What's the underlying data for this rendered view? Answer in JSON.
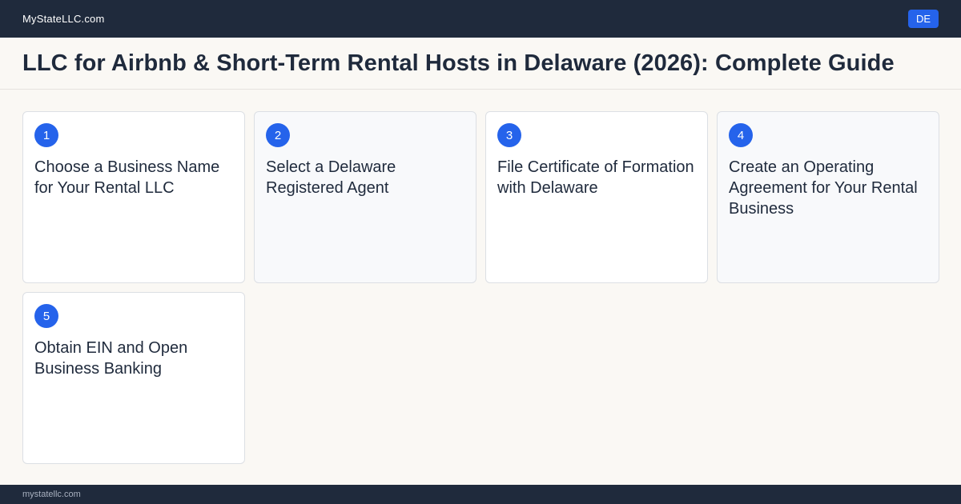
{
  "header": {
    "brand": "MyStateLLC.com",
    "state_badge": "DE"
  },
  "page": {
    "title": "LLC for Airbnb & Short-Term Rental Hosts in Delaware (2026): Complete Guide"
  },
  "steps": [
    {
      "number": "1",
      "title": "Choose a Business Name for Your Rental LLC"
    },
    {
      "number": "2",
      "title": "Select a Delaware Registered Agent"
    },
    {
      "number": "3",
      "title": "File Certificate of Formation with Delaware"
    },
    {
      "number": "4",
      "title": "Create an Operating Agreement for Your Rental Business"
    },
    {
      "number": "5",
      "title": "Obtain EIN and Open Business Banking"
    }
  ],
  "footer": {
    "domain": "mystatellc.com"
  }
}
